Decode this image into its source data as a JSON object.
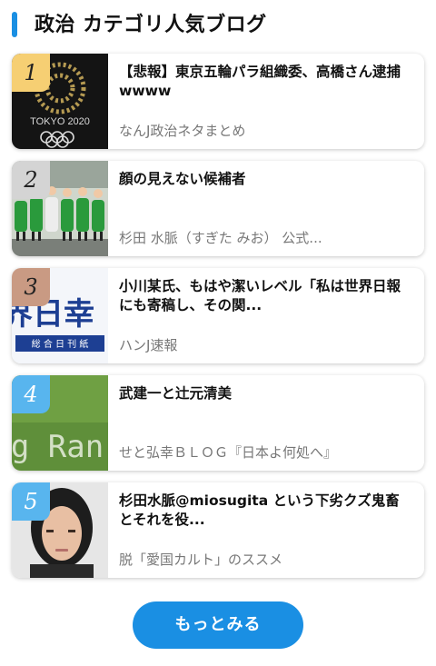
{
  "header": {
    "title": "政治 カテゴリ人気ブログ"
  },
  "items": [
    {
      "rank": "1",
      "title": "【悲報】東京五輪パラ組織委、高橋さん逮捕wwww",
      "source": "なんJ政治ネタまとめ",
      "thumb_text": "TOKYO 2020"
    },
    {
      "rank": "2",
      "title": "顔の見えない候補者",
      "source": "杉田 水脈（すぎた みお） 公式..."
    },
    {
      "rank": "3",
      "title": "小川某氏、もはや潔いレベル「私は世界日報にも寄稿し、その関...",
      "source": "ハンJ速報",
      "thumb_text": "界日幸",
      "thumb_subtext": "総 合 日 刊 紙"
    },
    {
      "rank": "4",
      "title": "武建一と辻元清美",
      "source": "せと弘幸ＢＬＯＧ『日本よ何処へ』",
      "thumb_text": "g Ran"
    },
    {
      "rank": "5",
      "title": "杉田水脈@miosugita という下劣クズ鬼畜とそれを役...",
      "source": "脱「愛国カルト」のススメ"
    }
  ],
  "more_button": {
    "label": "もっとみる"
  },
  "colors": {
    "accent": "#1a8fe3",
    "rank_gold": "#f6cf73",
    "rank_silver": "#d4d4d4",
    "rank_bronze": "#c99a83",
    "rank_blue": "#58b5ee"
  }
}
